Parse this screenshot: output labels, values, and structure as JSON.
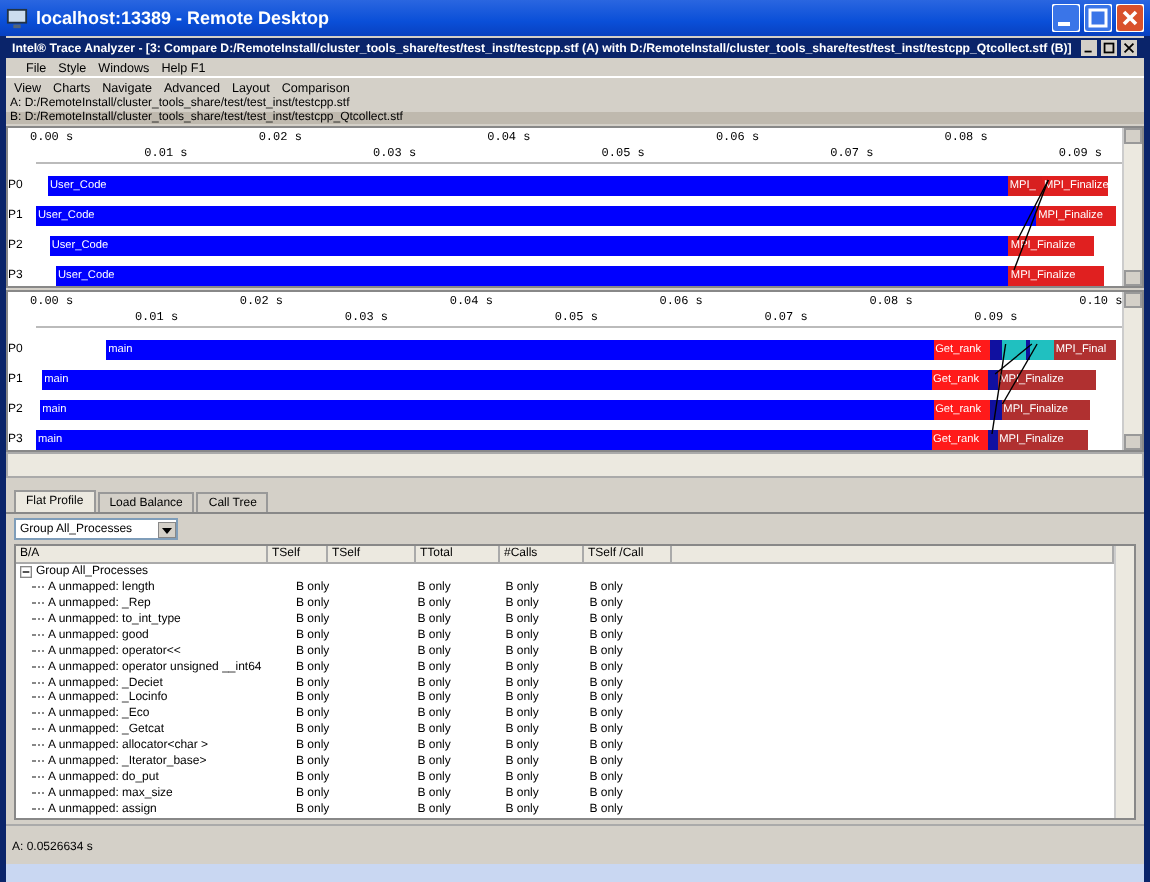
{
  "remote_window": {
    "title": "localhost:13389 - Remote Desktop"
  },
  "app_window": {
    "title": "Intel® Trace Analyzer - [3: Compare D:/RemoteInstall/cluster_tools_share/test/test_inst/testcpp.stf (A) with D:/RemoteInstall/cluster_tools_share/test/test_inst/testcpp_Qtcollect.stf (B)]"
  },
  "main_menu": [
    "File",
    "Style",
    "Windows",
    "Help F1"
  ],
  "chart_menu": [
    "View",
    "Charts",
    "Navigate",
    "Advanced",
    "Layout",
    "Comparison"
  ],
  "files": [
    "A: D:/RemoteInstall/cluster_tools_share/test/test_inst/testcpp.stf",
    "B: D:/RemoteInstall/cluster_tools_share/test/test_inst/testcpp_Qtcollect.stf"
  ],
  "timelines": [
    {
      "ticks_upper": [
        "0.00 s",
        "0.02 s",
        "0.04 s",
        "0.06 s",
        "0.08 s"
      ],
      "ticks_lower": [
        "0.01 s",
        "0.03 s",
        "0.05 s",
        "0.07 s",
        "0.09 s"
      ],
      "processes": [
        {
          "name": "P0",
          "segments": [
            {
              "label": "User_Code",
              "color": "#0000ff"
            },
            {
              "label": "MPI_",
              "color": "#d82020"
            },
            {
              "label": "MPI_Finalize",
              "color": "#e02020"
            }
          ]
        },
        {
          "name": "P1",
          "segments": [
            {
              "label": "User_Code",
              "color": "#0000ff"
            },
            {
              "label": "MPI_Finalize",
              "color": "#e02020"
            }
          ]
        },
        {
          "name": "P2",
          "segments": [
            {
              "label": "User_Code",
              "color": "#0000ff"
            },
            {
              "label": "MPI_Finalize",
              "color": "#e02020"
            }
          ]
        },
        {
          "name": "P3",
          "segments": [
            {
              "label": "User_Code",
              "color": "#0000ff"
            },
            {
              "label": "MPI_Finalize",
              "color": "#e02020"
            }
          ]
        }
      ]
    },
    {
      "ticks_upper": [
        "0.00 s",
        "0.02 s",
        "0.04 s",
        "0.06 s",
        "0.08 s",
        "0.10 s"
      ],
      "ticks_lower": [
        "0.01 s",
        "0.03 s",
        "0.05 s",
        "0.07 s",
        "0.09 s"
      ],
      "processes": [
        {
          "name": "P0",
          "segments": [
            {
              "label": "main",
              "color": "#0000ff"
            },
            {
              "label": "Get_rank",
              "color": "#ff1a1a"
            },
            {
              "color": "#1010a0"
            },
            {
              "color": "#20c0c0"
            },
            {
              "color": "#1010a0"
            },
            {
              "color": "#20c0c0"
            },
            {
              "label": "MPI_Final",
              "color": "#b03030"
            }
          ]
        },
        {
          "name": "P1",
          "segments": [
            {
              "label": "main",
              "color": "#0000ff"
            },
            {
              "label": "Get_rank",
              "color": "#ff1a1a"
            },
            {
              "color": "#1010a0"
            },
            {
              "label": "MPI_Finalize",
              "color": "#b03030"
            }
          ]
        },
        {
          "name": "P2",
          "segments": [
            {
              "label": "main",
              "color": "#0000ff"
            },
            {
              "label": "Get_rank",
              "color": "#ff1a1a"
            },
            {
              "color": "#1010a0"
            },
            {
              "label": "MPI_Finalize",
              "color": "#b03030"
            }
          ]
        },
        {
          "name": "P3",
          "segments": [
            {
              "label": "main",
              "color": "#0000ff"
            },
            {
              "label": "Get_rank",
              "color": "#ff1a1a"
            },
            {
              "color": "#1010a0"
            },
            {
              "label": "MPI_Finalize",
              "color": "#b03030"
            }
          ]
        }
      ]
    }
  ],
  "tabs": [
    {
      "label": "Flat Profile",
      "selected": true
    },
    {
      "label": "Load Balance",
      "selected": false
    },
    {
      "label": "Call Tree",
      "selected": false
    }
  ],
  "grouping": {
    "value": "Group All_Processes"
  },
  "table": {
    "columns": [
      "B/A",
      "TSelf",
      "TSelf",
      "TTotal",
      "#Calls",
      "TSelf /Call"
    ],
    "rows": [
      {
        "name": "Group All_Processes",
        "expanded": true,
        "children": [
          {
            "name": "A unmapped: length",
            "tself": "B only",
            "ttotal": "B only",
            "calls": "B only",
            "tself_call": "B only"
          },
          {
            "name": "A unmapped: _Rep",
            "tself": "B only",
            "ttotal": "B only",
            "calls": "B only",
            "tself_call": "B only"
          },
          {
            "name": "A unmapped: to_int_type",
            "tself": "B only",
            "ttotal": "B only",
            "calls": "B only",
            "tself_call": "B only"
          },
          {
            "name": "A unmapped: good",
            "tself": "B only",
            "ttotal": "B only",
            "calls": "B only",
            "tself_call": "B only"
          },
          {
            "name": "A unmapped: operator<<",
            "tself": "B only",
            "ttotal": "B only",
            "calls": "B only",
            "tself_call": "B only"
          },
          {
            "name": "A unmapped: operator unsigned __int64",
            "tself": "B only",
            "ttotal": "B only",
            "calls": "B only",
            "tself_call": "B only"
          },
          {
            "name": "A unmapped: _Deciet",
            "tself": "B only",
            "ttotal": "B only",
            "calls": "B only",
            "tself_call": "B only"
          },
          {
            "name": "A unmapped: _Locinfo",
            "tself": "B only",
            "ttotal": "B only",
            "calls": "B only",
            "tself_call": "B only"
          },
          {
            "name": "A unmapped: _Eco",
            "tself": "B only",
            "ttotal": "B only",
            "calls": "B only",
            "tself_call": "B only"
          },
          {
            "name": "A unmapped: _Getcat",
            "tself": "B only",
            "ttotal": "B only",
            "calls": "B only",
            "tself_call": "B only"
          },
          {
            "name": "A unmapped: allocator<char >",
            "tself": "B only",
            "ttotal": "B only",
            "calls": "B only",
            "tself_call": "B only"
          },
          {
            "name": "A unmapped: _Iterator_base>",
            "tself": "B only",
            "ttotal": "B only",
            "calls": "B only",
            "tself_call": "B only"
          },
          {
            "name": "A unmapped: do_put",
            "tself": "B only",
            "ttotal": "B only",
            "calls": "B only",
            "tself_call": "B only"
          },
          {
            "name": "A unmapped: max_size",
            "tself": "B only",
            "ttotal": "B only",
            "calls": "B only",
            "tself_call": "B only"
          },
          {
            "name": "A unmapped: assign",
            "tself": "B only",
            "ttotal": "B only",
            "calls": "B only",
            "tself_call": "B only"
          }
        ]
      }
    ]
  },
  "status": "A: 0.0526634 s"
}
